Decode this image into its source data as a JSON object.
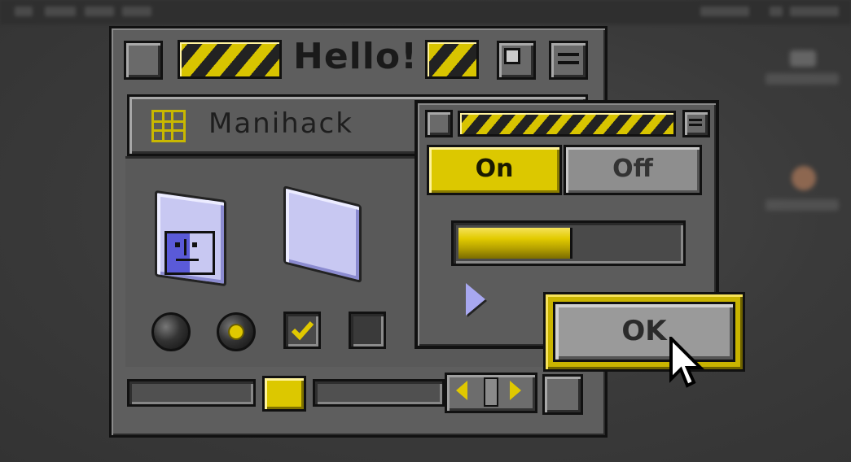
{
  "colors": {
    "accent": "#dcc800",
    "window": "#5e5e5e",
    "outline": "#111111",
    "folder": "#c8c8f2"
  },
  "main_window": {
    "title": "Hello!",
    "tab": {
      "label": "Manihack",
      "icon": "grid-icon"
    },
    "icons": [
      "finder-folder-icon",
      "folder-icon"
    ],
    "controls": {
      "radio_1": {
        "selected": false
      },
      "radio_2": {
        "selected": true
      },
      "checkbox_1": {
        "checked": true
      },
      "checkbox_2": {
        "checked": false
      }
    },
    "scrollbar": {
      "thumb_position": 0.28
    }
  },
  "sub_window": {
    "toggle": {
      "on_label": "On",
      "off_label": "Off",
      "selected": "On"
    },
    "progress": {
      "value": 0.52
    },
    "ok_label": "OK"
  }
}
